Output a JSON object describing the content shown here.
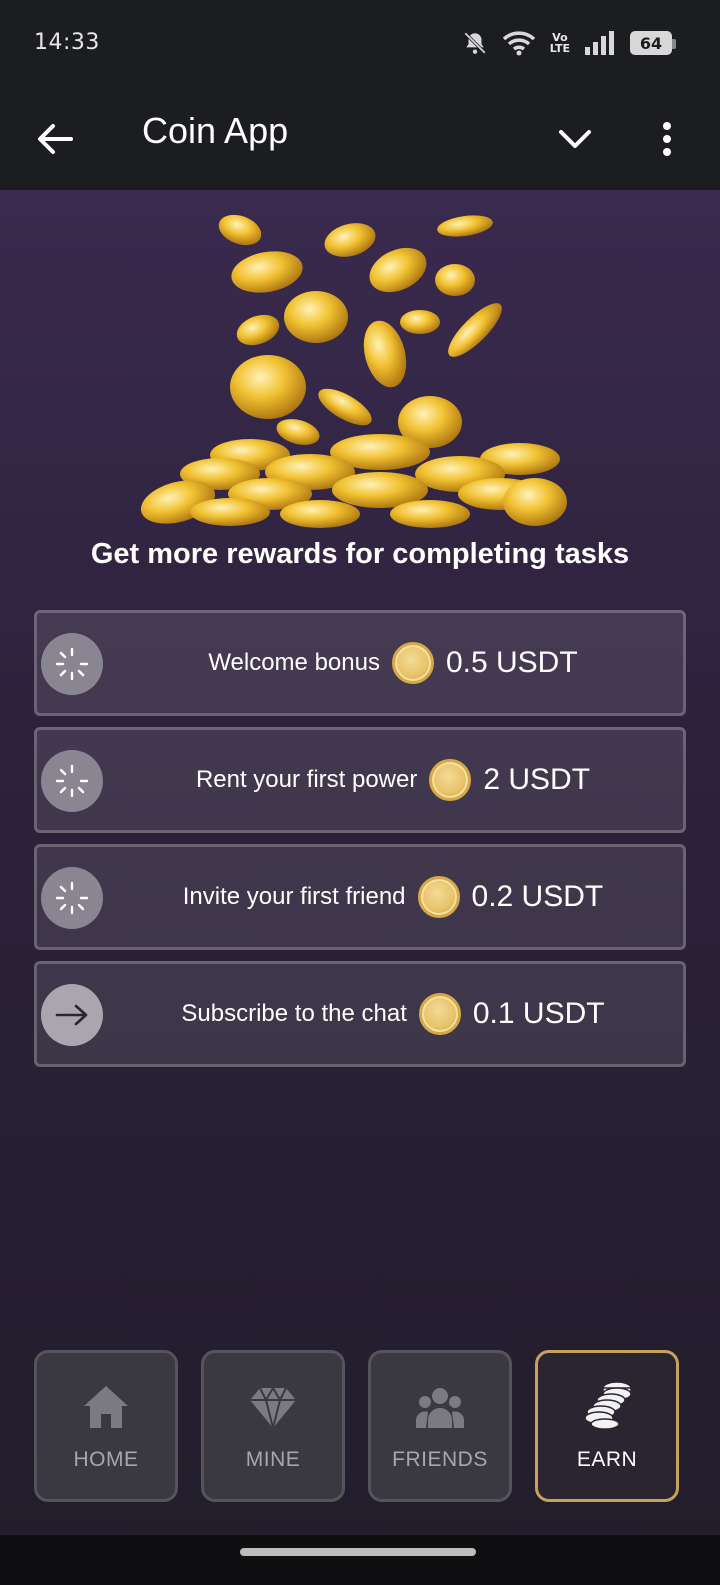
{
  "status_bar": {
    "time": "14:33",
    "network_label_top": "Vo",
    "network_label_bottom": "LTE",
    "battery": "64",
    "icons": [
      "bell-off-icon",
      "wifi-icon",
      "volte-icon",
      "signal-icon",
      "battery-icon"
    ]
  },
  "app_bar": {
    "title": "Coin App",
    "icons": [
      "back-arrow-icon",
      "chevron-down-icon",
      "more-vert-icon"
    ]
  },
  "main": {
    "headline": "Get more rewards for completing tasks",
    "tasks": [
      {
        "label": "Welcome bonus",
        "reward": "0.5 USDT",
        "status_icon": "spinner-icon"
      },
      {
        "label": "Rent your first power",
        "reward": "2 USDT",
        "status_icon": "spinner-icon"
      },
      {
        "label": "Invite your first friend",
        "reward": "0.2 USDT",
        "status_icon": "spinner-icon"
      },
      {
        "label": "Subscribe to the chat",
        "reward": "0.1 USDT",
        "status_icon": "arrow-right-icon"
      }
    ]
  },
  "bottom_nav": {
    "items": [
      {
        "label": "HOME",
        "icon": "home-icon",
        "active": false
      },
      {
        "label": "MINE",
        "icon": "diamond-icon",
        "active": false
      },
      {
        "label": "FRIENDS",
        "icon": "people-icon",
        "active": false
      },
      {
        "label": "EARN",
        "icon": "coin-stack-icon",
        "active": true
      }
    ]
  },
  "colors": {
    "accent_border": "#c9a25a",
    "coin_gold": "#e8c46a",
    "background_top": "#3a2a4e",
    "background_bottom": "#221d2b"
  }
}
